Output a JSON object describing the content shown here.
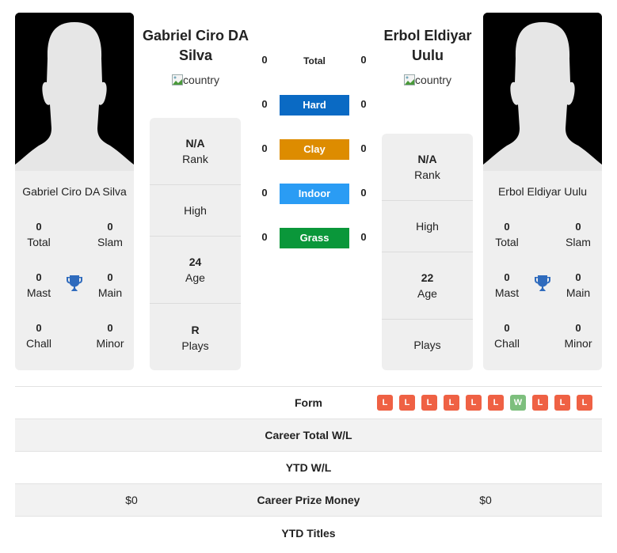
{
  "colors": {
    "hard": "#0a6ac4",
    "clay": "#dd8c00",
    "indoor": "#2a9cf4",
    "grass": "#0a973a",
    "loss": "#ef6144",
    "win": "#7dbf7d",
    "trophy": "#2f6bbd"
  },
  "player1": {
    "name": "Gabriel Ciro DA Silva",
    "flag_alt": "country",
    "titles": {
      "total": {
        "value": "0",
        "label": "Total"
      },
      "slam": {
        "value": "0",
        "label": "Slam"
      },
      "mast": {
        "value": "0",
        "label": "Mast"
      },
      "main": {
        "value": "0",
        "label": "Main"
      },
      "chall": {
        "value": "0",
        "label": "Chall"
      },
      "minor": {
        "value": "0",
        "label": "Minor"
      }
    },
    "stats": {
      "rank": {
        "value": "N/A",
        "label": "Rank"
      },
      "high": {
        "label": "High"
      },
      "age": {
        "value": "24",
        "label": "Age"
      },
      "plays": {
        "value": "R",
        "label": "Plays"
      }
    },
    "prize_money": "$0"
  },
  "player2": {
    "name": "Erbol Eldiyar Uulu",
    "flag_alt": "country",
    "titles": {
      "total": {
        "value": "0",
        "label": "Total"
      },
      "slam": {
        "value": "0",
        "label": "Slam"
      },
      "mast": {
        "value": "0",
        "label": "Mast"
      },
      "main": {
        "value": "0",
        "label": "Main"
      },
      "chall": {
        "value": "0",
        "label": "Chall"
      },
      "minor": {
        "value": "0",
        "label": "Minor"
      }
    },
    "stats": {
      "rank": {
        "value": "N/A",
        "label": "Rank"
      },
      "high": {
        "label": "High"
      },
      "age": {
        "value": "22",
        "label": "Age"
      },
      "plays": {
        "label": "Plays"
      }
    },
    "prize_money": "$0",
    "form": [
      "L",
      "L",
      "L",
      "L",
      "L",
      "L",
      "W",
      "L",
      "L",
      "L"
    ]
  },
  "h2h": {
    "total": {
      "label": "Total",
      "p1": "0",
      "p2": "0"
    },
    "hard": {
      "label": "Hard",
      "p1": "0",
      "p2": "0"
    },
    "clay": {
      "label": "Clay",
      "p1": "0",
      "p2": "0"
    },
    "indoor": {
      "label": "Indoor",
      "p1": "0",
      "p2": "0"
    },
    "grass": {
      "label": "Grass",
      "p1": "0",
      "p2": "0"
    }
  },
  "comparison": {
    "form_label": "Form",
    "career_wl_label": "Career Total W/L",
    "ytd_wl_label": "YTD W/L",
    "prize_label": "Career Prize Money",
    "ytd_titles_label": "YTD Titles"
  }
}
